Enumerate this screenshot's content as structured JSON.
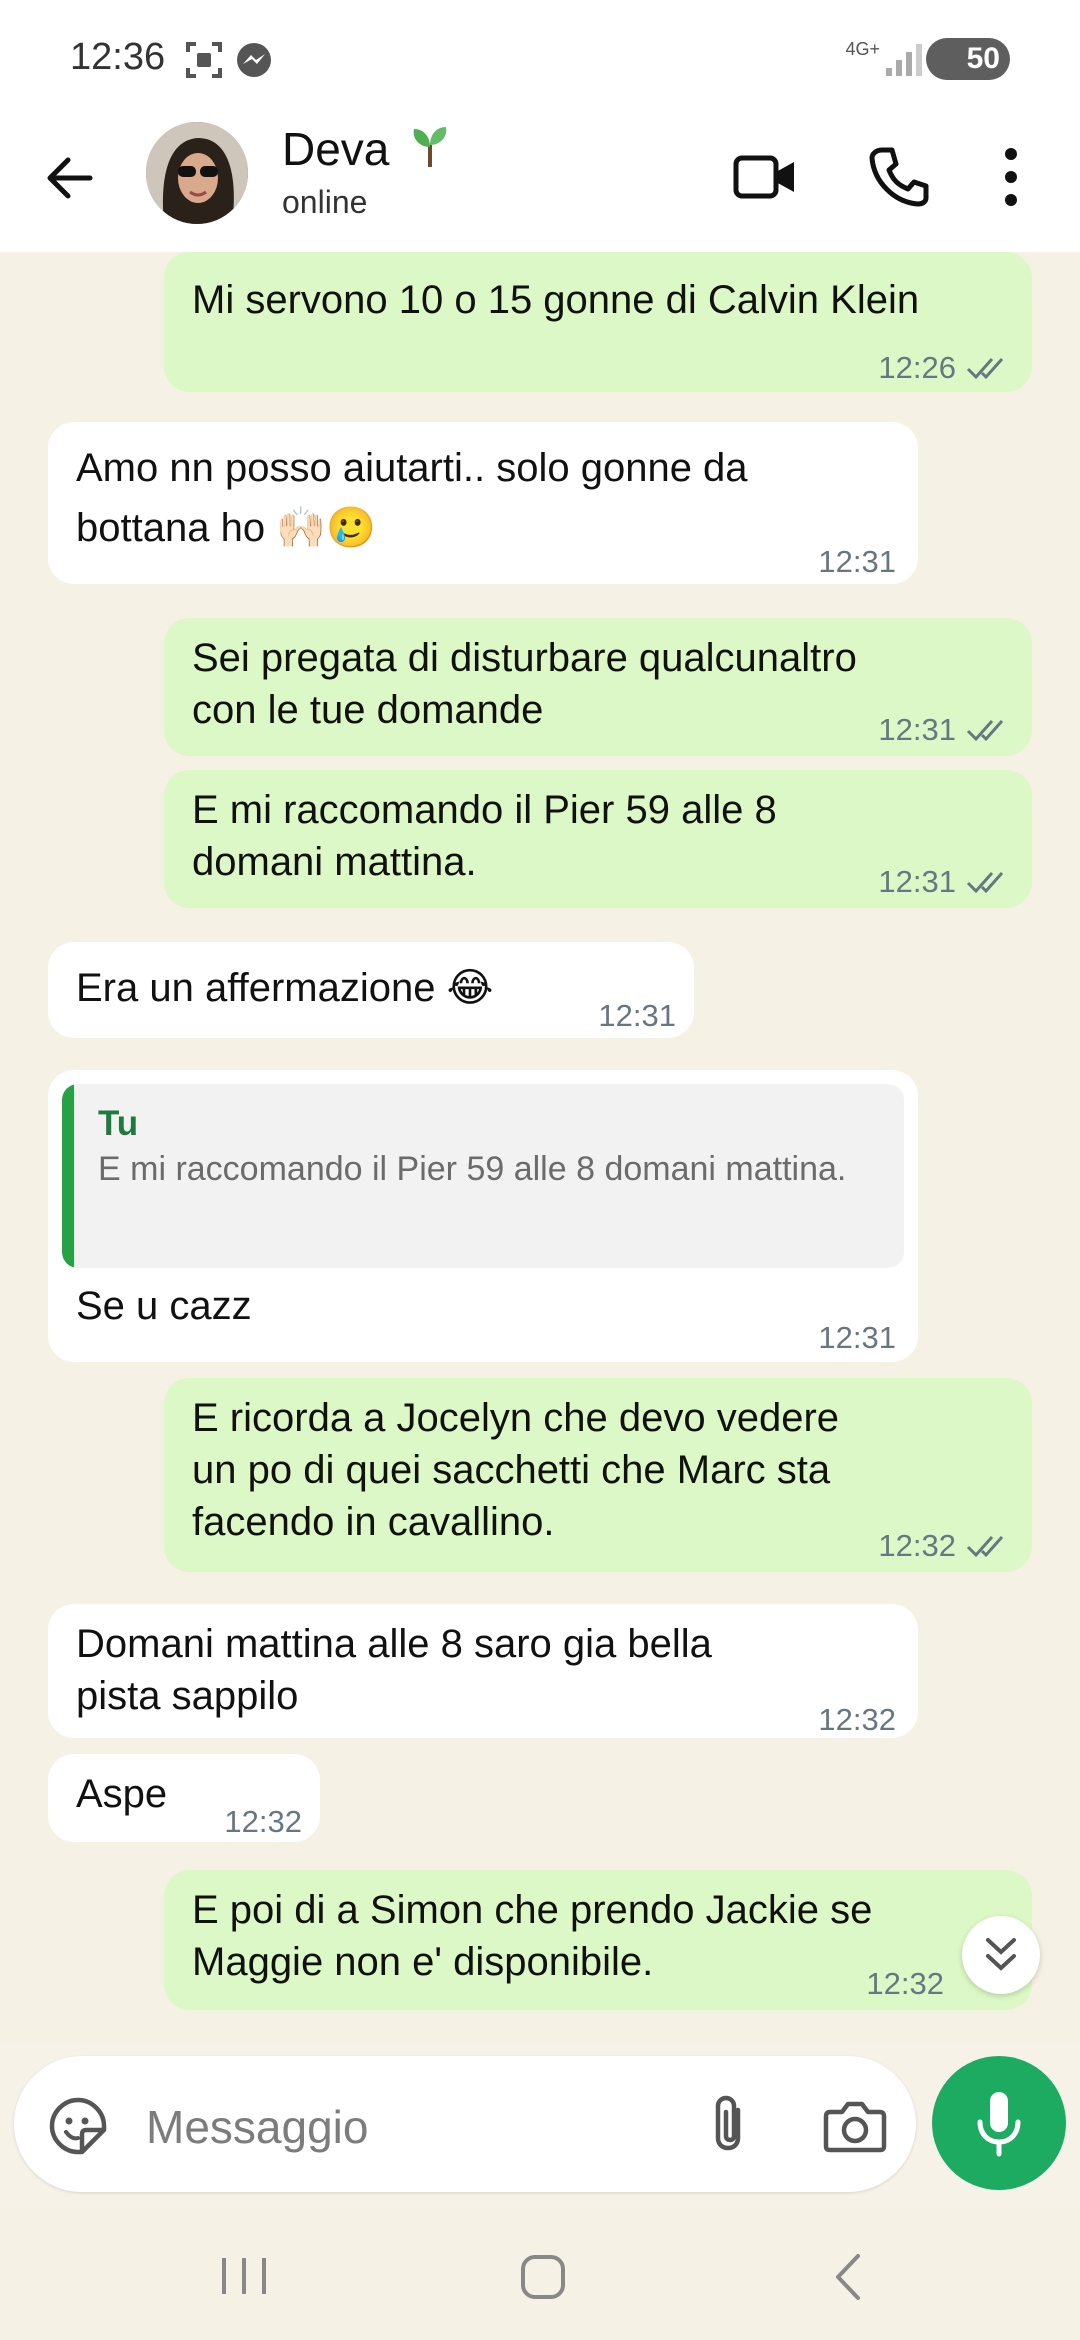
{
  "status_bar": {
    "time": "12:36",
    "network": "4G+",
    "battery": "50"
  },
  "header": {
    "name": "Deva",
    "status": "online"
  },
  "messages": [
    {
      "dir": "out",
      "text": "Mi servono 10 o 15 gonne di Calvin Klein",
      "time": "12:26",
      "read": true
    },
    {
      "dir": "in",
      "text": "Amo nn posso aiutarti.. solo gonne da\nbottana ho 🙌🏻🥲",
      "time": "12:31"
    },
    {
      "dir": "out",
      "text": "Sei pregata di disturbare qualcunaltro\ncon le tue domande",
      "time": "12:31",
      "read": true
    },
    {
      "dir": "out",
      "text": "E mi raccomando il Pier 59 alle 8\ndomani mattina.",
      "time": "12:31",
      "read": true
    },
    {
      "dir": "in",
      "text": "Era un affermazione 😂",
      "time": "12:31"
    },
    {
      "dir": "in",
      "quote_author": "Tu",
      "quote_text": "E mi raccomando il Pier 59 alle 8 domani mattina.",
      "text": "Se u cazz",
      "time": "12:31"
    },
    {
      "dir": "out",
      "text": "E ricorda a Jocelyn che devo vedere\nun po di quei sacchetti che Marc sta\nfacendo in cavallino.",
      "time": "12:32",
      "read": true
    },
    {
      "dir": "in",
      "text": "Domani mattina alle 8 saro gia bella\npista sappilo",
      "time": "12:32"
    },
    {
      "dir": "in",
      "text": "Aspe",
      "time": "12:32"
    },
    {
      "dir": "out",
      "text": "E poi di a Simon che prendo Jackie se\nMaggie non e' disponibile.",
      "time": "12:32",
      "read": false
    }
  ],
  "composer": {
    "placeholder": "Messaggio"
  },
  "colors": {
    "outgoing_bubble": "#DCF8C6",
    "incoming_bubble": "#FFFFFF",
    "accent_green": "#1DAA61",
    "read_ticks": "#667781"
  }
}
